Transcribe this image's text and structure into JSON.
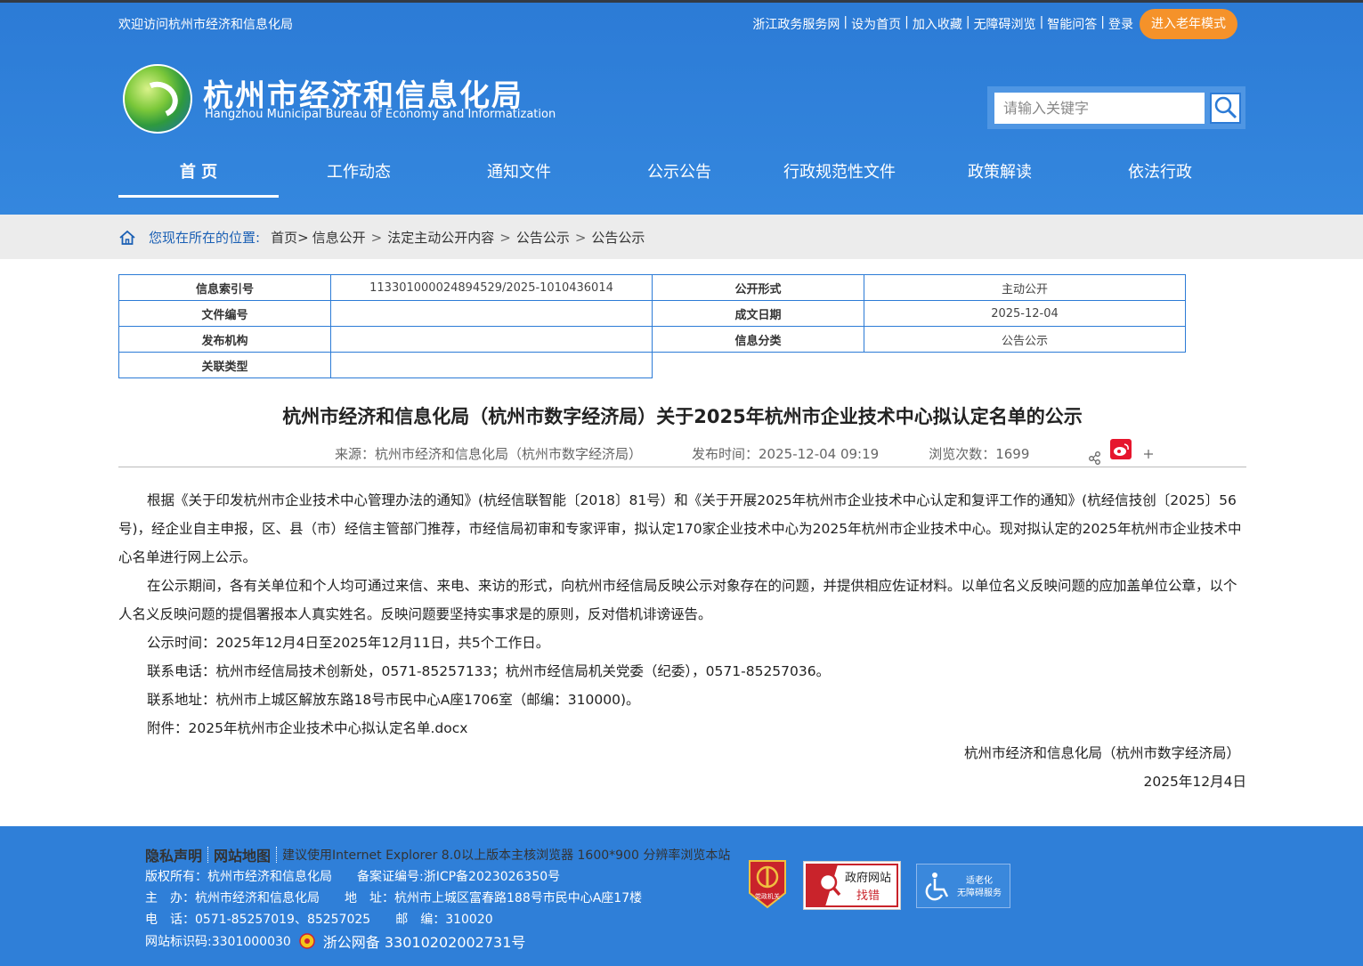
{
  "header": {
    "welcome": "欢迎访问杭州市经济和信息化局",
    "top_links": [
      "浙江政务服务网",
      "设为首页",
      "加入收藏",
      "无障碍浏览",
      "智能问答",
      "登录"
    ],
    "elder_mode": "进入老年模式",
    "site_title": "杭州市经济和信息化局",
    "site_subtitle": "Hangzhou Municipal Bureau of Economy and Informatization",
    "search_placeholder": "请输入关键字"
  },
  "nav": [
    "首 页",
    "工作动态",
    "通知文件",
    "公示公告",
    "行政规范性文件",
    "政策解读",
    "依法行政"
  ],
  "breadcrumb": {
    "label": "您现在所在的位置:",
    "items": [
      "首页>",
      "信息公开",
      "法定主动公开内容",
      "公告公示",
      "公告公示"
    ]
  },
  "meta": {
    "rows": [
      {
        "k1": "信息索引号",
        "v1": "113301000024894529/2025-1010436014",
        "k2": "公开形式",
        "v2": "主动公开"
      },
      {
        "k1": "文件编号",
        "v1": "",
        "k2": "成文日期",
        "v2": "2025-12-04"
      },
      {
        "k1": "发布机构",
        "v1": "",
        "k2": "信息分类",
        "v2": "公告公示"
      },
      {
        "k1": "关联类型",
        "v1": ""
      }
    ]
  },
  "article": {
    "title": "杭州市经济和信息化局（杭州市数字经济局）关于2025年杭州市企业技术中心拟认定名单的公示",
    "source": "来源：杭州市经济和信息化局（杭州市数字经济局）",
    "publish_time": "发布时间：2025-12-04 09:19",
    "views": "浏览次数：1699",
    "paragraphs": [
      "根据《关于印发杭州市企业技术中心管理办法的通知》(杭经信联智能〔2018〕81号）和《关于开展2025年杭州市企业技术中心认定和复评工作的通知》(杭经信技创〔2025〕56号)，经企业自主申报，区、县（市）经信主管部门推荐，市经信局初审和专家评审，拟认定170家企业技术中心为2025年杭州市企业技术中心。现对拟认定的2025年杭州市企业技术中心名单进行网上公示。",
      "在公示期间，各有关单位和个人均可通过来信、来电、来访的形式，向杭州市经信局反映公示对象存在的问题，并提供相应佐证材料。以单位名义反映问题的应加盖单位公章，以个人名义反映问题的提倡署报本人真实姓名。反映问题要坚持实事求是的原则，反对借机诽谤诬告。",
      "公示时间：2025年12月4日至2025年12月11日，共5个工作日。",
      "联系电话：杭州市经信局技术创新处，0571-85257133；杭州市经信局机关党委（纪委），0571-85257036。",
      "联系地址：杭州市上城区解放东路18号市民中心A座1706室（邮编：310000)。",
      "附件：2025年杭州市企业技术中心拟认定名单.docx"
    ],
    "signature": "杭州市经济和信息化局（杭州市数字经济局）",
    "sign_date": "2025年12月4日"
  },
  "footer": {
    "privacy": "隐私声明",
    "sitemap": "网站地图",
    "browser_note": "建议使用Internet Explorer 8.0以上版本主核浏览器 1600*900 分辨率浏览本站",
    "copyright": "版权所有：杭州市经济和信息化局　　备案证编号:浙ICP备2023026350号",
    "host": "主　办：杭州市经济和信息化局　　地　址：杭州市上城区富春路188号市民中心A座17楼",
    "phone": "电　话：0571-85257019、85257025　　邮　编：310020",
    "site_id": "网站标识码:3301000030",
    "police": "浙公网备 33010202002731号",
    "badge_party": "党政机关",
    "badge_gov_1": "政府网站",
    "badge_gov_2": "找错",
    "badge_access_1": "适老化",
    "badge_access_2": "无障碍服务"
  }
}
